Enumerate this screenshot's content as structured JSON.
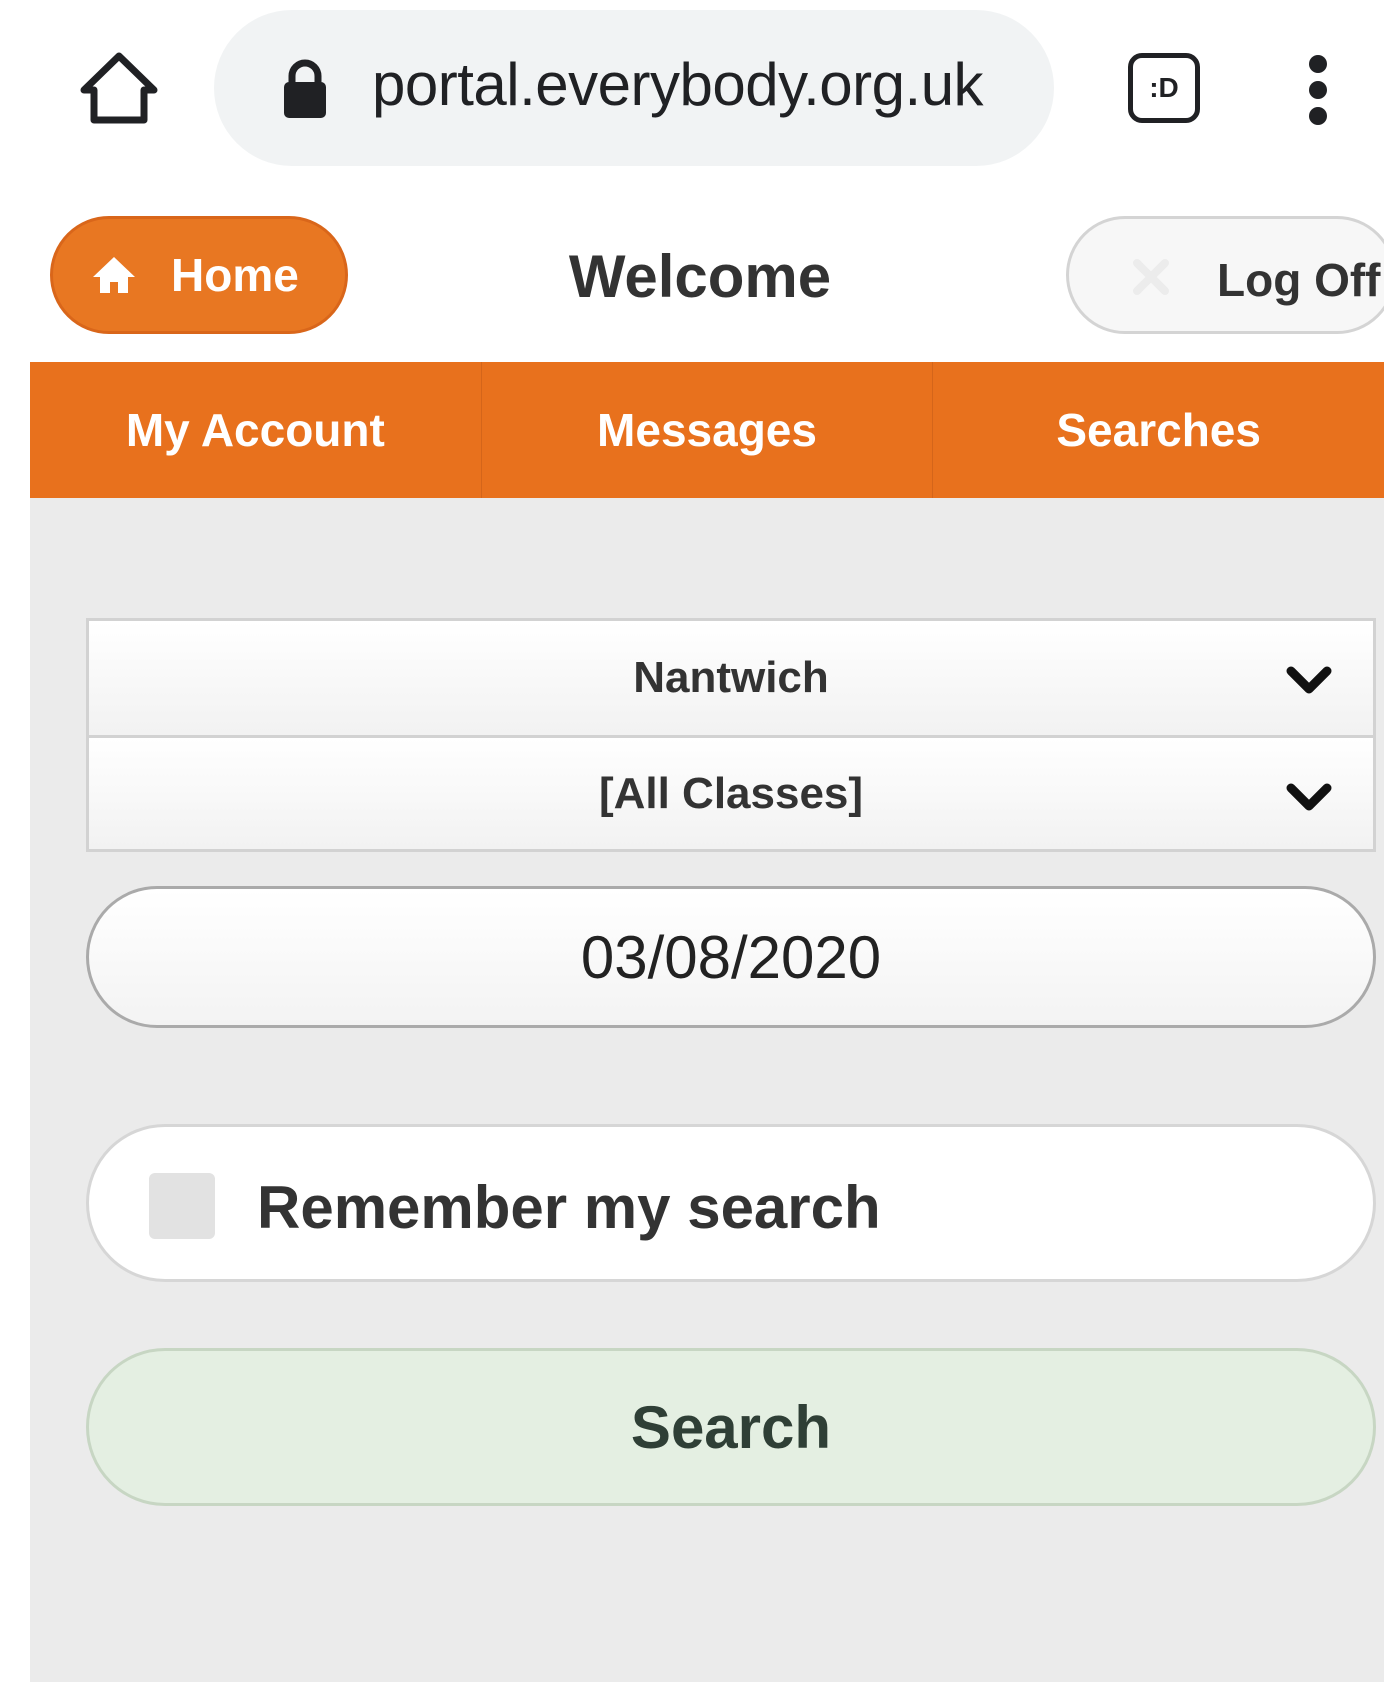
{
  "browser": {
    "url": "portal.everybody.org.uk",
    "tabs_label": ":D"
  },
  "header": {
    "home_label": "Home",
    "title": "Welcome",
    "logoff_label": "Log Off"
  },
  "nav": {
    "items": [
      {
        "label": "My Account"
      },
      {
        "label": "Messages"
      },
      {
        "label": "Searches"
      }
    ]
  },
  "form": {
    "location_value": "Nantwich",
    "class_value": "[All Classes]",
    "date_value": "03/08/2020",
    "remember_label": "Remember my search",
    "remember_checked": false,
    "search_label": "Search"
  },
  "colors": {
    "accent": "#e8711d",
    "search_button_bg": "#e4efe2",
    "page_bg": "#ebebeb"
  },
  "icons": {
    "chrome_home": "home-outline-icon",
    "lock": "lock-icon",
    "tabs": "tab-switcher-icon",
    "menu": "kebab-menu-icon",
    "home": "home-icon",
    "logoff": "close-icon",
    "dropdown": "chevron-down-icon"
  }
}
